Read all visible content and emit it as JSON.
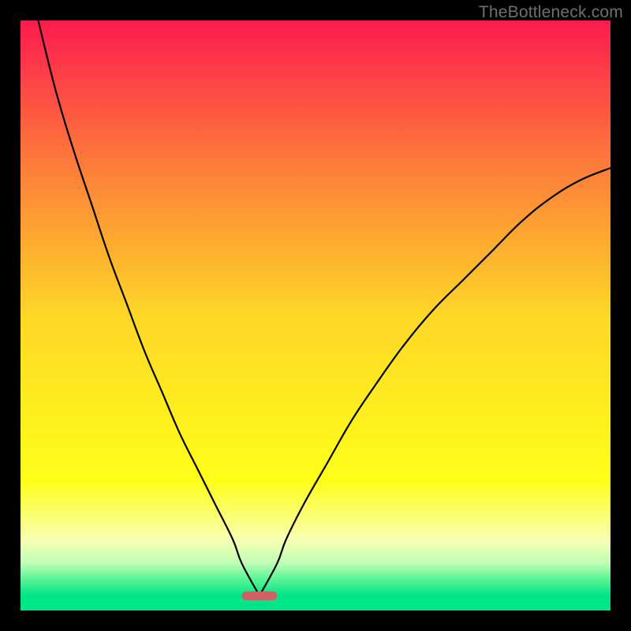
{
  "watermark": "TheBottleneck.com",
  "chart_data": {
    "type": "line",
    "title": "",
    "xlabel": "",
    "ylabel": "",
    "xlim": [
      0,
      100
    ],
    "ylim": [
      0,
      100
    ],
    "grid": false,
    "legend": false,
    "background_gradient": {
      "stops": [
        {
          "offset": 0.0,
          "color": "#fc1b4e"
        },
        {
          "offset": 0.25,
          "color": "#fd7e3a"
        },
        {
          "offset": 0.5,
          "color": "#fed727"
        },
        {
          "offset": 0.78,
          "color": "#feff19"
        },
        {
          "offset": 0.88,
          "color": "#f9ffb3"
        },
        {
          "offset": 0.92,
          "color": "#beffb6"
        },
        {
          "offset": 0.945,
          "color": "#60f597"
        },
        {
          "offset": 0.975,
          "color": "#00e588"
        },
        {
          "offset": 1.0,
          "color": "#00e588"
        }
      ]
    },
    "marker": {
      "x": 40.5,
      "y": 97.5,
      "width": 6,
      "height": 1.5,
      "color": "#cb6363",
      "shape": "rounded-rect"
    },
    "series": [
      {
        "name": "curve",
        "color": "#000000",
        "x": [
          3,
          6,
          9,
          12,
          15,
          18,
          21,
          24,
          27,
          30,
          33,
          36,
          37.5,
          40.5,
          43.5,
          45,
          48,
          52,
          56,
          60,
          65,
          70,
          75,
          80,
          85,
          90,
          95,
          100
        ],
        "values": [
          0,
          12,
          22,
          31,
          40,
          48,
          56,
          63,
          70,
          76,
          82,
          88,
          92,
          97.5,
          92,
          88,
          82,
          75,
          68,
          62,
          55,
          49,
          44,
          39,
          34,
          30,
          27,
          25
        ]
      }
    ]
  }
}
